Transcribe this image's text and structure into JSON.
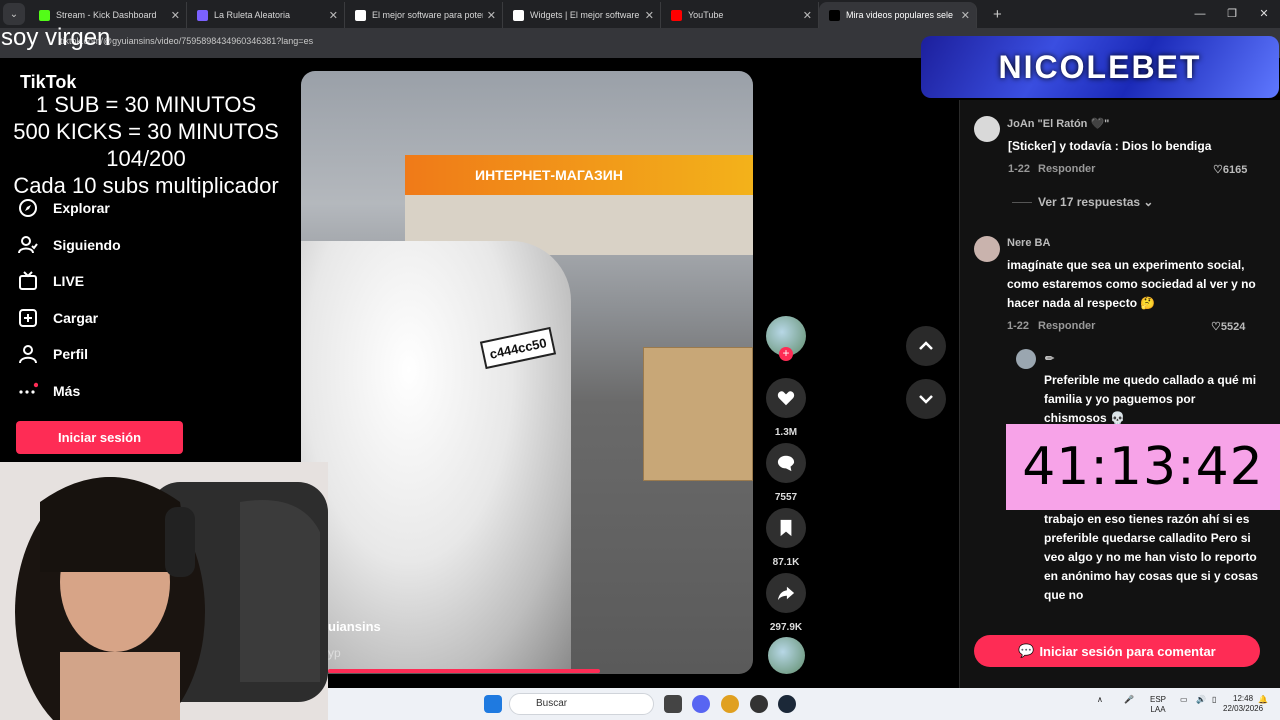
{
  "browser": {
    "tabs": [
      {
        "title": "Stream - Kick Dashboard",
        "favicon": "kick-icon",
        "color": "#53fc18"
      },
      {
        "title": "La Ruleta Aleatoria",
        "favicon": "ruleta-icon",
        "color": "#7b61ff"
      },
      {
        "title": "El mejor software para potencia",
        "favicon": "streamelements-icon",
        "color": "#ffffff"
      },
      {
        "title": "Widgets | El mejor software pa",
        "favicon": "streamelements-icon",
        "color": "#ffffff"
      },
      {
        "title": "YouTube",
        "favicon": "youtube-icon",
        "color": "#ff0000"
      },
      {
        "title": "Mira videos populares sele",
        "favicon": "tiktok-icon",
        "color": "#000000"
      }
    ],
    "url": "tiktok.com/@gyuiansins/video/7595898434960346381?lang=es"
  },
  "overlay": {
    "top_text": "soy virgen",
    "lines": [
      "1 SUB     = 30 MINUTOS",
      "500 KICKS = 30 MINUTOS",
      "104/200",
      "Cada 10 subs multiplicador"
    ]
  },
  "tiktok": {
    "logo": "TikTok",
    "nav": [
      {
        "label": "Explorar",
        "icon": "compass-icon"
      },
      {
        "label": "Siguiendo",
        "icon": "following-icon"
      },
      {
        "label": "LIVE",
        "icon": "live-icon"
      },
      {
        "label": "Cargar",
        "icon": "upload-icon"
      },
      {
        "label": "Perfil",
        "icon": "profile-icon"
      },
      {
        "label": "Más",
        "icon": "more-icon"
      }
    ],
    "login_label": "Iniciar sesión"
  },
  "video": {
    "store_sign": "ИНТЕРНЕТ-МАГАЗИН",
    "plate": "с444сс50",
    "author": "uiansins",
    "tag": "yp",
    "progress_fraction": 0.6
  },
  "actions": {
    "likes": "1.3M",
    "comments": "7557",
    "saves": "87.1K",
    "shares": "297.9K"
  },
  "banner": {
    "text": "NICOLEBET"
  },
  "comments": {
    "c1": {
      "user": "JoAn \"El Ratón 🖤\"",
      "text": "[Sticker] y todavía : Dios lo bendiga",
      "date": "1-22",
      "reply": "Responder",
      "likes": "6165"
    },
    "more_replies": "Ver 17 respuestas",
    "c2": {
      "user": "Nere BA",
      "text": "imagínate que sea un experimento social, como estaremos como sociedad al ver y no hacer nada al respecto 🤔",
      "date": "1-22",
      "reply": "Responder",
      "likes": "5524"
    },
    "c3": {
      "user": "✏",
      "text": "Preferible me quedo callado a qué mi familia y yo paguemos por chismosos 💀"
    },
    "c4": {
      "text": "trabajo en eso tienes razón ahí si es preferible quedarse calladito Pero si veo algo y no me han visto lo reporto en anónimo hay cosas que si y cosas que no"
    },
    "timer": "41:13:42",
    "comment_button": "Iniciar sesión para comentar"
  },
  "taskbar": {
    "search_placeholder": "Buscar",
    "lang_top": "ESP",
    "lang_bottom": "LAA",
    "time": "12:48",
    "date": "22/03/2026"
  }
}
